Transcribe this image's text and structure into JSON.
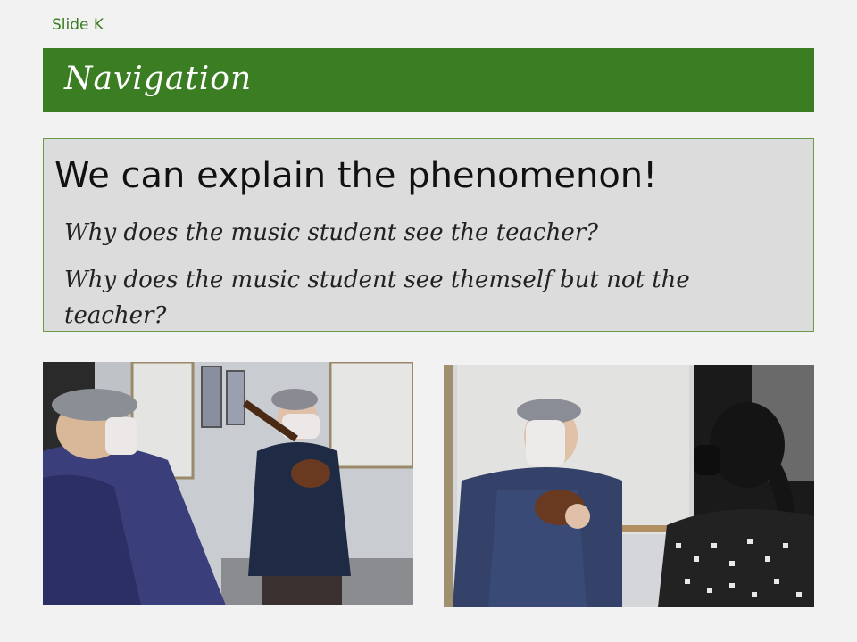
{
  "slide": {
    "label": "Slide K",
    "title": "Navigation",
    "accent_color": "#3a7d22"
  },
  "content": {
    "headline": "We can explain the phenomenon!",
    "questions": [
      "Why does the music student see the teacher?",
      "Why does the music student see themself but not the teacher?"
    ]
  },
  "photos": [
    {
      "icon": "photo-student-ukulele-mirror"
    },
    {
      "icon": "photo-student-and-teacher-mirror"
    }
  ]
}
